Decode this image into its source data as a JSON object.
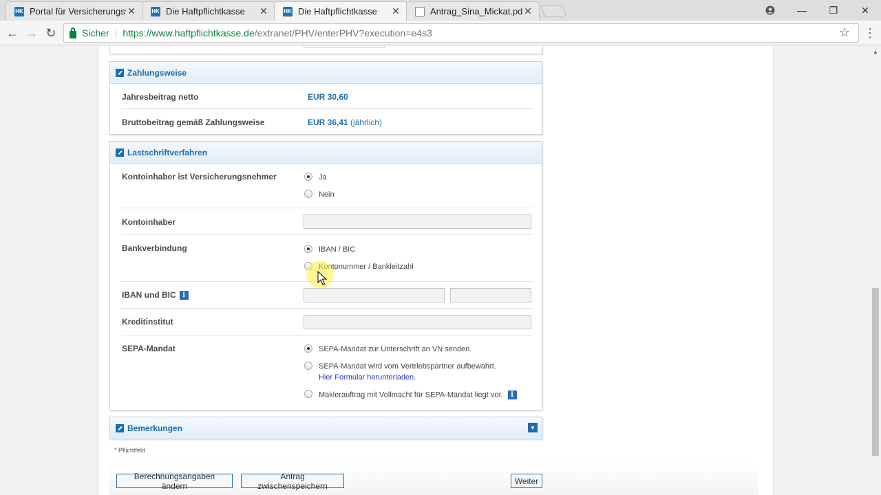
{
  "browser": {
    "tabs": [
      {
        "label": "Portal für Versicherungsv",
        "favicon": "HK",
        "active": false
      },
      {
        "label": "Die Haftpflichtkasse",
        "favicon": "HK",
        "active": false
      },
      {
        "label": "Die Haftpflichtkasse",
        "favicon": "HK",
        "active": true
      },
      {
        "label": "Antrag_Sina_Mickat.pdf",
        "favicon": "document-icon",
        "active": false
      }
    ],
    "secure_label": "Sicher",
    "url_scheme_host": "https://www.haftpflichtkasse.de",
    "url_path": "/extranet/PHV/enterPHV?execution=e4s3"
  },
  "zahlungsweise": {
    "title": "Zahlungsweise",
    "rows": [
      {
        "label": "Jahresbeitrag netto",
        "value": "EUR 30,60",
        "suffix": ""
      },
      {
        "label": "Bruttobeitrag gemäß Zahlungsweise",
        "value": "EUR 36,41",
        "suffix": "(jährlich)"
      }
    ]
  },
  "lastschrift": {
    "title": "Lastschriftverfahren",
    "kontoinhaber_vn": {
      "label": "Kontoinhaber ist Versicherungsnehmer",
      "options": [
        {
          "label": "Ja",
          "selected": true
        },
        {
          "label": "Nein",
          "selected": false
        }
      ]
    },
    "kontoinhaber": {
      "label": "Kontoinhaber",
      "value": ""
    },
    "bankverbindung": {
      "label": "Bankverbindung",
      "options": [
        {
          "label": "IBAN / BIC",
          "selected": true
        },
        {
          "label": "Kontonummer / Bankleitzahl",
          "selected": false
        }
      ]
    },
    "iban_bic": {
      "label": "IBAN und BIC",
      "iban": "",
      "bic": ""
    },
    "kreditinstitut": {
      "label": "Kreditinstitut",
      "value": ""
    },
    "sepa": {
      "label": "SEPA-Mandat",
      "options": [
        {
          "label": "SEPA-Mandat zur Unterschrift an VN senden.",
          "selected": true
        },
        {
          "label": "SEPA-Mandat wird vom Vertriebspartner aufbewahrt.",
          "link": "Hier Formular herunterladen.",
          "selected": false
        },
        {
          "label": "Maklerauftrag mit Vollmacht für SEPA-Mandat liegt vor.",
          "selected": false
        }
      ]
    }
  },
  "bemerkungen": {
    "title": "Bemerkungen"
  },
  "footnote": "* Pflichtfeld",
  "buttons": {
    "change": "Berechnungsangaben ändern",
    "save": "Antrag zwischenspeichern",
    "next": "Weiter"
  },
  "colors": {
    "accent": "#1a6bb0",
    "secure": "#0b8043"
  }
}
